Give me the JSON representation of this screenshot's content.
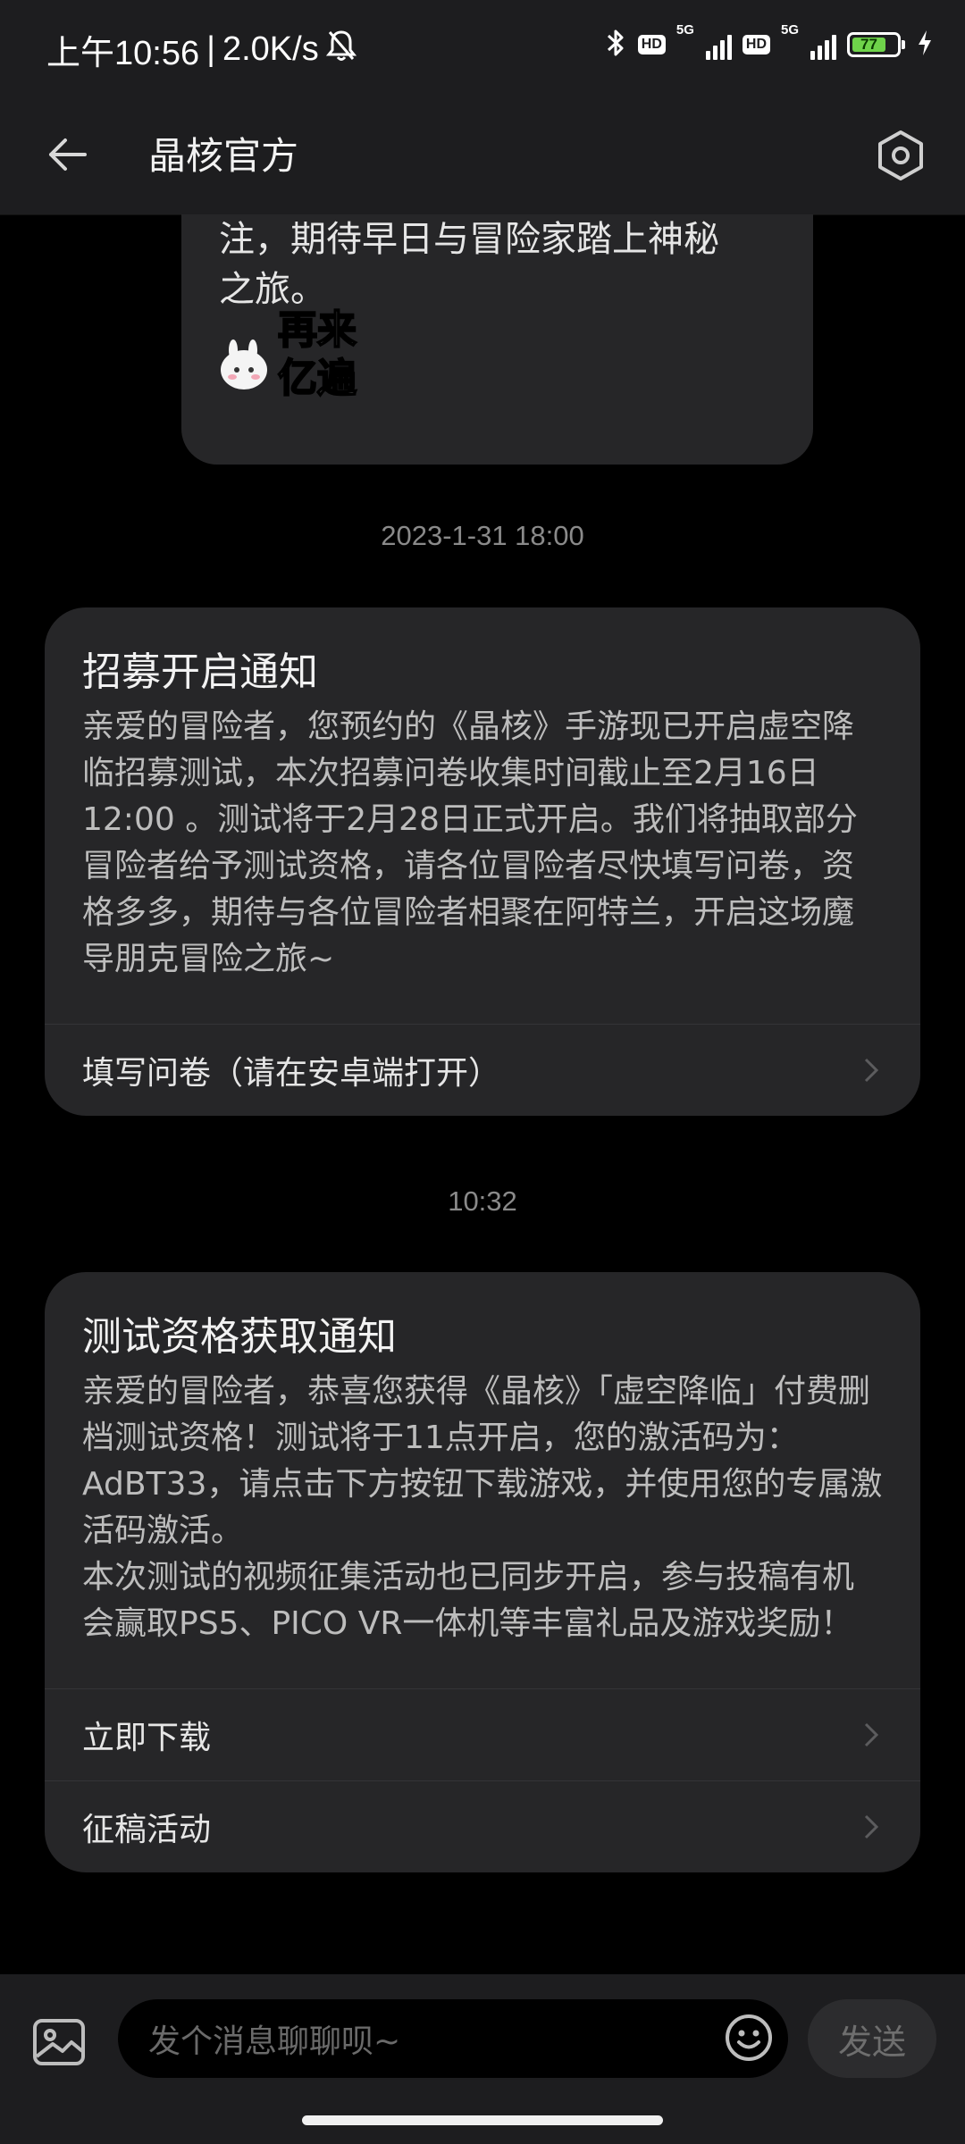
{
  "status_bar": {
    "time": "上午10:56",
    "separator": "|",
    "network_speed": "2.0K/s",
    "sim1_tag": "5G",
    "sim2_tag": "5G",
    "hd1": "HD",
    "hd2": "HD",
    "battery_level": "77",
    "icons": [
      "mute-bell-icon",
      "bluetooth-icon",
      "signal-icon",
      "battery-icon",
      "charging-icon"
    ]
  },
  "header": {
    "title": "晶核官方",
    "back_icon": "arrow-left-icon",
    "settings_icon": "hexagon-settings-icon"
  },
  "messages": {
    "previous_clip_line1": "注，期待早日与冒险家踏上神秘",
    "previous_clip_line2": "之旅。",
    "sticker_text1": "再来",
    "sticker_text2": "亿遍",
    "timestamp1": "2023-1-31 18:00",
    "card1": {
      "title": "招募开启通知",
      "text": "亲爱的冒险者，您预约的《晶核》手游现已开启虚空降临招募测试，本次招募问卷收集时间截止至2月16日12:00 。测试将于2月28日正式开启。我们将抽取部分冒险者给予测试资格，请各位冒险者尽快填写问卷，资格多多，期待与各位冒险者相聚在阿特兰，开启这场魔导朋克冒险之旅~",
      "action1": "填写问卷（请在安卓端打开）"
    },
    "timestamp2": "10:32",
    "card2": {
      "title": "测试资格获取通知",
      "text": "亲爱的冒险者，恭喜您获得《晶核》「虚空降临」付费删档测试资格！测试将于11点开启，您的激活码为：AdBT33，请点击下方按钮下载游戏，并使用您的专属激活码激活。\n本次测试的视频征集活动也已同步开启，参与投稿有机会赢取PS5、PICO VR一体机等丰富礼品及游戏奖励！",
      "action1": "立即下载",
      "action2": "征稿活动"
    }
  },
  "input_bar": {
    "placeholder": "发个消息聊聊呗~",
    "send_label": "发送",
    "image_icon": "image-icon",
    "emoji_icon": "smiley-icon"
  },
  "colors": {
    "background": "#000000",
    "surface": "#1d1d1f",
    "card": "#262628",
    "battery_green": "#6fd34a"
  }
}
